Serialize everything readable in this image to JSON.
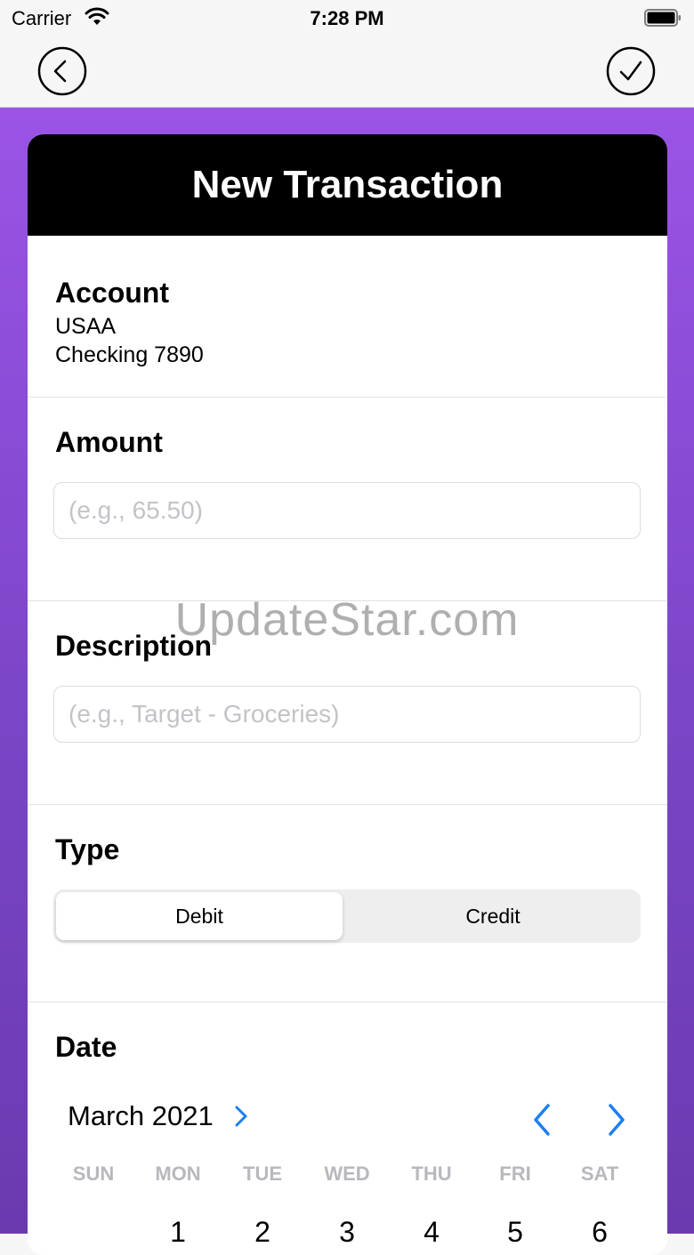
{
  "status_bar": {
    "carrier": "Carrier",
    "time": "7:28 PM"
  },
  "nav": {
    "back_icon": "chevron-left-circle-icon",
    "done_icon": "checkmark-circle-icon"
  },
  "card": {
    "title": "New Transaction",
    "account": {
      "label": "Account",
      "bank": "USAA",
      "name": "Checking 7890"
    },
    "amount": {
      "label": "Amount",
      "placeholder": "(e.g., 65.50)",
      "value": ""
    },
    "description": {
      "label": "Description",
      "placeholder": "(e.g., Target - Groceries)",
      "value": ""
    },
    "type": {
      "label": "Type",
      "options": [
        "Debit",
        "Credit"
      ],
      "selected": "Debit"
    },
    "date": {
      "label": "Date",
      "month": "March 2021",
      "weekdays": [
        "SUN",
        "MON",
        "TUE",
        "WED",
        "THU",
        "FRI",
        "SAT"
      ],
      "first_week_days": [
        "",
        "1",
        "2",
        "3",
        "4",
        "5",
        "6"
      ]
    }
  },
  "watermark": "UpdateStar.com",
  "colors": {
    "accent": "#1c7ff0",
    "gradient_top": "#9b54e6",
    "gradient_bottom": "#6b3aaf"
  }
}
